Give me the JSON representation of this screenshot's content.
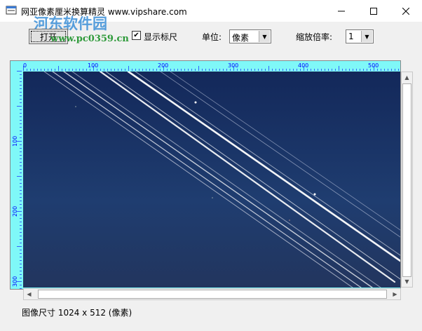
{
  "window": {
    "title": "网亚像素厘米换算精灵 www.vipshare.com",
    "minimize_label": "—",
    "maximize_label": "☐",
    "close_label": "✕"
  },
  "watermark": {
    "line1": "河东软件园",
    "line2": "www.pc0359.cn"
  },
  "toolbar": {
    "open_label": "打开",
    "show_ruler_label": "显示标尺",
    "show_ruler_checked": true,
    "unit_label": "单位:",
    "unit_value": "像素",
    "zoom_label": "缩放倍率:",
    "zoom_value": "1"
  },
  "ruler": {
    "top_labels": [
      "0",
      "100",
      "200",
      "300",
      "400",
      "500"
    ],
    "left_labels": [
      "100",
      "200",
      "300"
    ]
  },
  "status": {
    "size_text": "图像尺寸  1024 x 512  (像素)"
  },
  "icons": {
    "app": "app-icon",
    "scroll_up": "scroll-up-icon",
    "scroll_down": "scroll-down-icon",
    "scroll_left": "scroll-left-icon",
    "scroll_right": "scroll-right-icon"
  }
}
